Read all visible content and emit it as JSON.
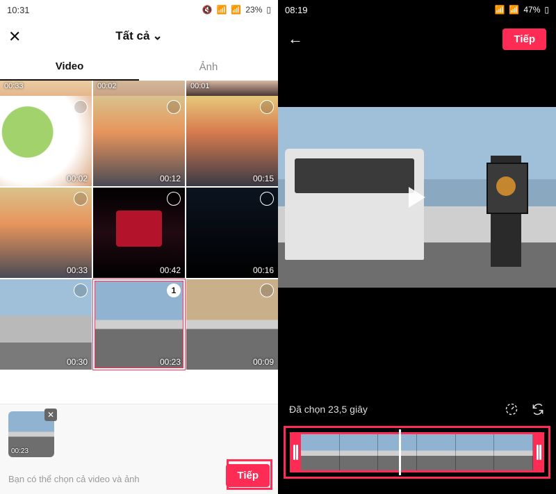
{
  "left": {
    "status": {
      "time": "10:31",
      "battery": "23%"
    },
    "header": {
      "title": "Tất cả"
    },
    "tabs": {
      "video": "Video",
      "photo": "Ảnh"
    },
    "partial_row": [
      "00:33",
      "00:02",
      "00:01"
    ],
    "grid": [
      {
        "dur": "00:02"
      },
      {
        "dur": "00:12"
      },
      {
        "dur": "00:15"
      },
      {
        "dur": "00:33"
      },
      {
        "dur": "00:42"
      },
      {
        "dur": "00:16"
      },
      {
        "dur": "00:30"
      },
      {
        "dur": "00:23",
        "selected": true,
        "order": "1"
      },
      {
        "dur": "00:09"
      }
    ],
    "selected_thumb_dur": "00:23",
    "hint": "Bạn có thể chọn cả video và ảnh",
    "next": "Tiếp"
  },
  "right": {
    "status": {
      "time": "08:19",
      "battery": "47%"
    },
    "next": "Tiếp",
    "selected_text": "Đã chọn 23,5 giây"
  }
}
